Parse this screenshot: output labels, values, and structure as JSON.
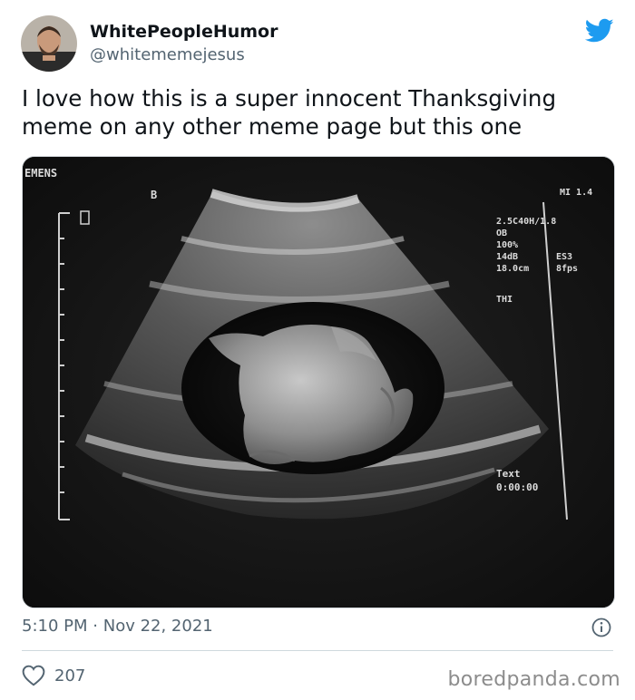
{
  "author": {
    "display_name": "WhitePeopleHumor",
    "handle": "@whitememejesus"
  },
  "tweet": {
    "text": "I love how this is a super innocent Thanksgiving meme on any other meme page but this one",
    "time": "5:10 PM",
    "separator": "·",
    "date": "Nov 22, 2021",
    "like_count": "207"
  },
  "image": {
    "brand": "EMENS",
    "probe_mark": "B",
    "mi_label": "MI 1.4",
    "settings": [
      "2.5C40H/1.8",
      "OB",
      "100%",
      "14dB",
      "18.0cm",
      "THI"
    ],
    "settings_right": [
      "ES3",
      "8fps"
    ],
    "text_label": "Text",
    "timer": "0:00:00"
  },
  "icons": {
    "bird": "twitter-bird-icon",
    "info": "info-icon",
    "like": "heart-icon"
  },
  "colors": {
    "twitter_blue": "#1d9bf0",
    "secondary_text": "#536471"
  },
  "watermark": "boredpanda.com"
}
